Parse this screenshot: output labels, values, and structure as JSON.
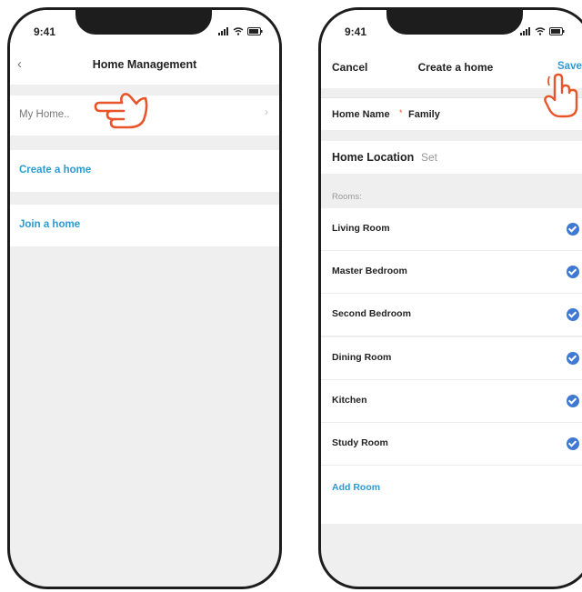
{
  "status": {
    "time": "9:41"
  },
  "home_management": {
    "title": "Home Management",
    "my_home": "My Home..",
    "create_home": "Create a home",
    "join_home": "Join a home"
  },
  "create_home": {
    "cancel": "Cancel",
    "title": "Create a home",
    "save": "Save",
    "home_name_label": "Home Name",
    "home_name_value": "Family",
    "home_location_label": "Home Location",
    "home_location_value": "Set",
    "rooms_header": "Rooms:",
    "rooms": [
      "Living Room",
      "Master Bedroom",
      "Second Bedroom",
      "Dining Room",
      "Kitchen",
      "Study Room"
    ],
    "add_room": "Add Room"
  },
  "colors": {
    "accent": "#2b9bd3",
    "check": "#3f79d1",
    "hand": "#e8552b"
  }
}
